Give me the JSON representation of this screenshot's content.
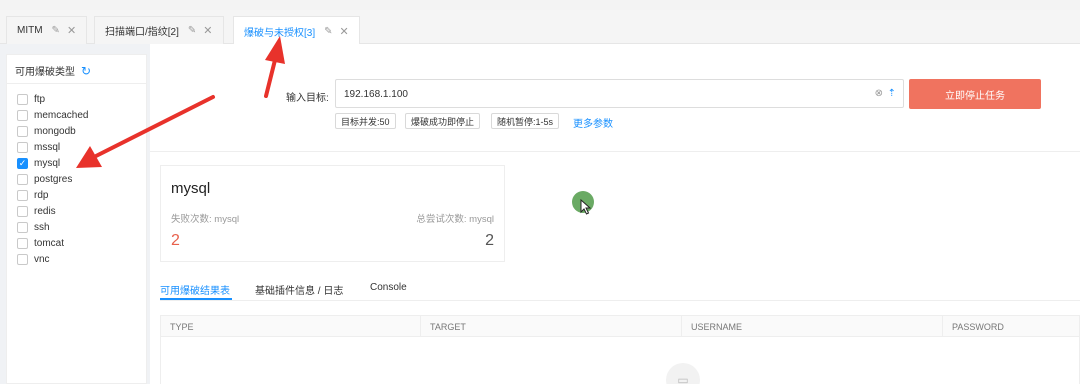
{
  "tabs": [
    {
      "label": "MITM"
    },
    {
      "label": "扫描端口/指纹[2]"
    },
    {
      "label": "爆破与未授权[3]"
    }
  ],
  "sidebar": {
    "title": "可用爆破类型",
    "options": [
      {
        "label": "ftp",
        "checked": false
      },
      {
        "label": "memcached",
        "checked": false
      },
      {
        "label": "mongodb",
        "checked": false
      },
      {
        "label": "mssql",
        "checked": false
      },
      {
        "label": "mysql",
        "checked": true
      },
      {
        "label": "postgres",
        "checked": false
      },
      {
        "label": "rdp",
        "checked": false
      },
      {
        "label": "redis",
        "checked": false
      },
      {
        "label": "ssh",
        "checked": false
      },
      {
        "label": "tomcat",
        "checked": false
      },
      {
        "label": "vnc",
        "checked": false
      }
    ]
  },
  "form": {
    "target_label": "输入目标:",
    "target_value": "192.168.1.100",
    "stop_button": "立即停止任务",
    "params": [
      "目标并发:50",
      "爆破成功即停止",
      "随机暂停:1-5s"
    ],
    "more_params": "更多参数"
  },
  "card": {
    "title": "mysql",
    "fail_label": "失败次数: mysql",
    "fail_count": "2",
    "total_label": "总尝试次数: mysql",
    "total_count": "2"
  },
  "result_tabs": [
    "可用爆破结果表",
    "基础插件信息 / 日志",
    "Console"
  ],
  "table": {
    "columns": [
      "TYPE",
      "TARGET",
      "USERNAME",
      "PASSWORD"
    ]
  },
  "colors": {
    "accent": "#1890ff",
    "stop_button": "#f0735f",
    "fail_count": "#e8604c",
    "annotation_arrow": "#e8322b"
  },
  "icons": {
    "edit": "pencil-icon",
    "close": "close-icon",
    "refresh": "refresh-icon",
    "clear": "clear-icon",
    "upload": "upload-icon",
    "empty": "empty-data-icon"
  }
}
